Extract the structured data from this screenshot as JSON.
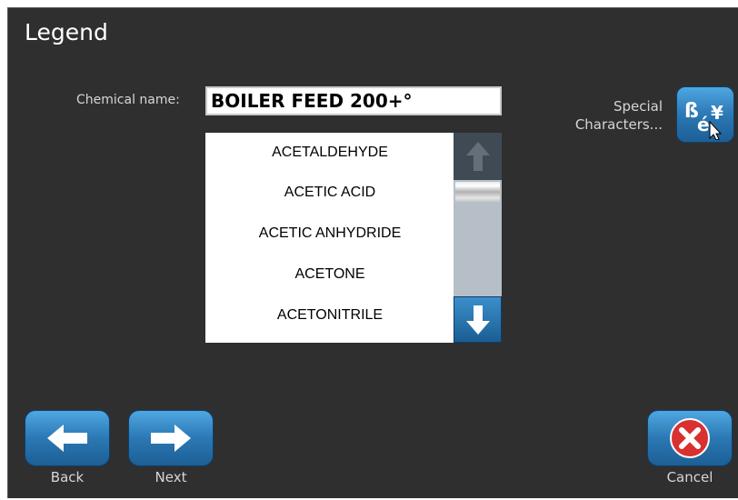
{
  "window": {
    "title": "Legend"
  },
  "chemical_name": {
    "label": "Chemical name:",
    "value": "BOILER FEED 200+°"
  },
  "list": {
    "items": [
      "ACETALDEHYDE",
      "ACETIC ACID",
      "ACETIC ANHYDRIDE",
      "ACETONE",
      "ACETONITRILE"
    ]
  },
  "special_characters": {
    "label_line1": "Special",
    "label_line2": "Characters...",
    "icon": "special-characters-icon"
  },
  "footer": {
    "back_label": "Back",
    "next_label": "Next",
    "cancel_label": "Cancel"
  },
  "colors": {
    "background": "#2f2f2f",
    "button_blue": "#2b78b4",
    "cancel_red": "#d93030"
  }
}
